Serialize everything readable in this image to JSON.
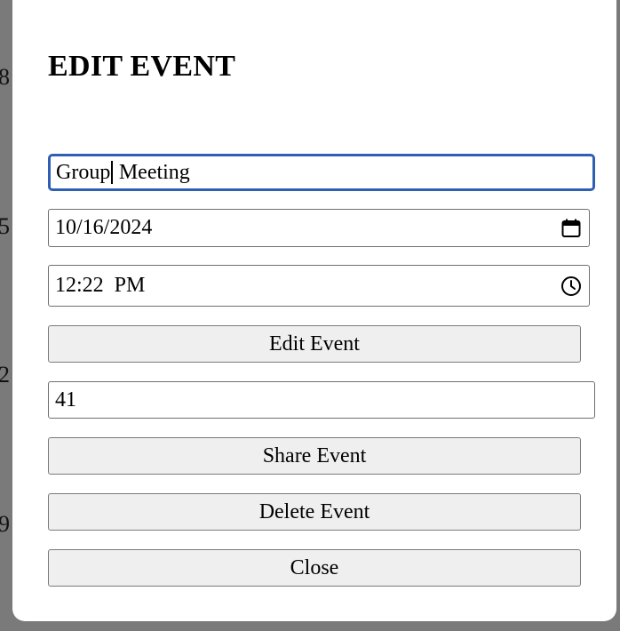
{
  "background": {
    "digits": [
      "8",
      "5",
      "2",
      "9"
    ]
  },
  "modal": {
    "title": "EDIT EVENT",
    "name_field": {
      "value_before_caret": "Group",
      "value_after_caret": " Meeting"
    },
    "date_field": {
      "value": "10/16/2024",
      "icon": "calendar-icon"
    },
    "time_field": {
      "value": "12:22  PM",
      "icon": "clock-icon"
    },
    "edit_button_label": "Edit Event",
    "share_field": {
      "value": "41"
    },
    "share_button_label": "Share Event",
    "delete_button_label": "Delete Event",
    "close_button_label": "Close"
  },
  "colors": {
    "overlay": "#7a7a7a",
    "focus_border": "#2f5fb5",
    "button_bg": "#efefef"
  }
}
